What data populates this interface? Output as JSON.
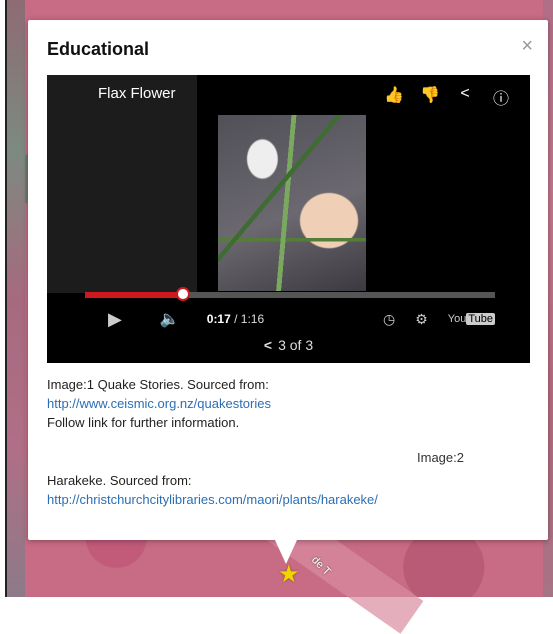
{
  "popup": {
    "title": "Educational",
    "close": "×"
  },
  "video": {
    "title": "Flax Flower",
    "icons": [
      "thumbs-up-icon",
      "thumbs-down-icon",
      "share-icon",
      "info-icon"
    ],
    "current_time": "0:17",
    "duration": " / 1:16",
    "progress": 0.24,
    "logo_prefix": "You",
    "logo_tube": "Tube"
  },
  "pager": {
    "label": "3 of 3"
  },
  "content": {
    "image1_label": "Image:1 Quake Stories. Sourced from:",
    "image1_link": "http://www.ceismic.org.nz/quakestories",
    "follow_text": "Follow link for further information.",
    "image2_label": "Image:2",
    "harakeke_label": "Harakeke. Sourced from:",
    "harakeke_link": "http://christchurchcitylibraries.com/maori/plants/harakeke/"
  },
  "map": {
    "road_label": "de T"
  },
  "colors": {
    "accent": "#cc181e",
    "link": "#2a6fb5"
  }
}
